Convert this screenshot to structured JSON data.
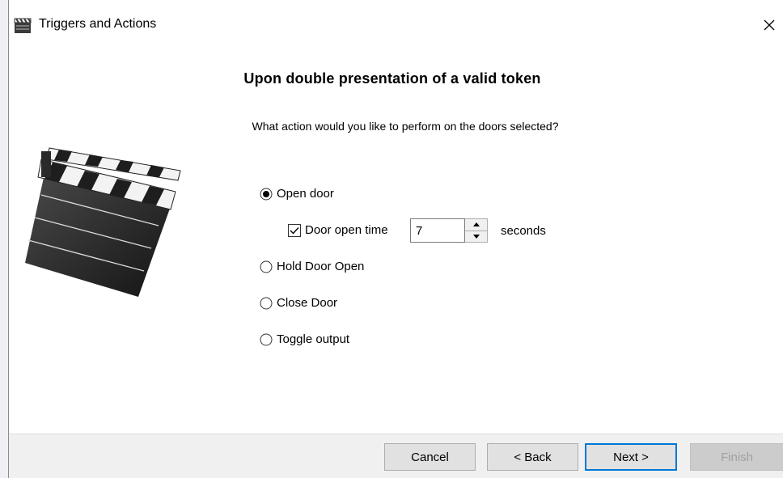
{
  "window": {
    "title": "Triggers and Actions",
    "close_glyph": "✕"
  },
  "page": {
    "heading": "Upon double presentation of a valid token",
    "question": "What action would you like to perform on the doors selected?"
  },
  "options": {
    "open_door": {
      "label": "Open door",
      "selected": true
    },
    "door_open_time": {
      "label": "Door open time",
      "checked": true,
      "value": "7",
      "unit": "seconds"
    },
    "hold_door_open": {
      "label": "Hold Door Open",
      "selected": false
    },
    "close_door": {
      "label": "Close Door",
      "selected": false
    },
    "toggle_output": {
      "label": "Toggle output",
      "selected": false
    }
  },
  "buttons": {
    "cancel": "Cancel",
    "back": "< Back",
    "next": "Next >",
    "finish": "Finish"
  },
  "colors": {
    "accent": "#0078d7",
    "footer_bg": "#f0f0f0",
    "disabled_text": "#a0a0a0"
  },
  "icons": {
    "app": "clapperboard-icon",
    "close": "close-icon",
    "illustration": "clapperboard-illustration"
  }
}
